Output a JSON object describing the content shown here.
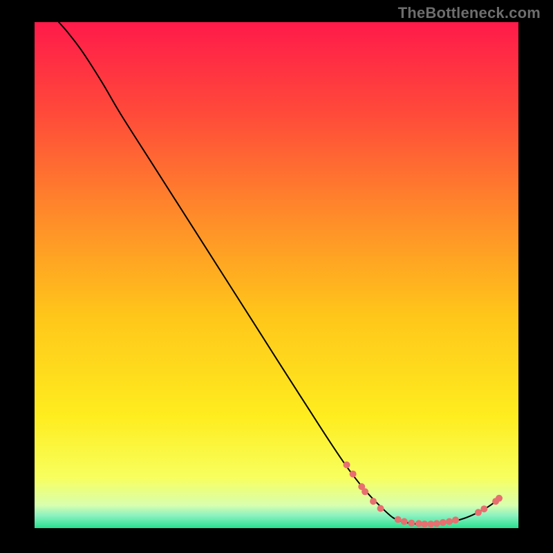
{
  "watermark": "TheBottleneck.com",
  "chart_data": {
    "type": "line",
    "title": "",
    "xlabel": "",
    "ylabel": "",
    "xlim": [
      0,
      100
    ],
    "ylim": [
      0,
      100
    ],
    "grid": false,
    "legend": false,
    "series": [
      {
        "name": "curve",
        "color": "#000000",
        "stroke_width": 2,
        "points": [
          {
            "x": 5.0,
            "y": 100.0
          },
          {
            "x": 7.0,
            "y": 97.8
          },
          {
            "x": 10.0,
            "y": 94.0
          },
          {
            "x": 14.0,
            "y": 88.0
          },
          {
            "x": 18.0,
            "y": 81.5
          },
          {
            "x": 25.0,
            "y": 71.0
          },
          {
            "x": 35.0,
            "y": 56.0
          },
          {
            "x": 45.0,
            "y": 41.0
          },
          {
            "x": 55.0,
            "y": 26.0
          },
          {
            "x": 65.0,
            "y": 11.5
          },
          {
            "x": 72.0,
            "y": 3.8
          },
          {
            "x": 76.0,
            "y": 1.3
          },
          {
            "x": 82.0,
            "y": 0.8
          },
          {
            "x": 88.0,
            "y": 1.7
          },
          {
            "x": 93.0,
            "y": 3.8
          },
          {
            "x": 96.0,
            "y": 5.8
          }
        ]
      },
      {
        "name": "dots",
        "type": "scatter",
        "color": "#e76f6f",
        "radius": 5,
        "points": [
          {
            "x": 64.5,
            "y": 12.5
          },
          {
            "x": 65.8,
            "y": 10.7
          },
          {
            "x": 67.6,
            "y": 8.2
          },
          {
            "x": 68.3,
            "y": 7.2
          },
          {
            "x": 70.0,
            "y": 5.3
          },
          {
            "x": 71.5,
            "y": 3.9
          },
          {
            "x": 75.1,
            "y": 1.7
          },
          {
            "x": 76.4,
            "y": 1.3
          },
          {
            "x": 77.9,
            "y": 1.0
          },
          {
            "x": 79.4,
            "y": 0.9
          },
          {
            "x": 80.6,
            "y": 0.8
          },
          {
            "x": 81.9,
            "y": 0.8
          },
          {
            "x": 83.1,
            "y": 0.9
          },
          {
            "x": 84.4,
            "y": 1.1
          },
          {
            "x": 85.7,
            "y": 1.3
          },
          {
            "x": 87.0,
            "y": 1.6
          },
          {
            "x": 91.7,
            "y": 3.1
          },
          {
            "x": 92.9,
            "y": 3.8
          },
          {
            "x": 95.3,
            "y": 5.3
          },
          {
            "x": 96.0,
            "y": 5.9
          }
        ]
      }
    ],
    "background": {
      "type": "linear-gradient",
      "direction": "vertical",
      "stops": [
        {
          "offset": 0.0,
          "color": "#ff1a4a"
        },
        {
          "offset": 0.18,
          "color": "#ff4a3a"
        },
        {
          "offset": 0.38,
          "color": "#ff8a2a"
        },
        {
          "offset": 0.58,
          "color": "#ffc61a"
        },
        {
          "offset": 0.78,
          "color": "#feed1f"
        },
        {
          "offset": 0.9,
          "color": "#f8ff5e"
        },
        {
          "offset": 0.955,
          "color": "#d8ffb0"
        },
        {
          "offset": 0.975,
          "color": "#8cf2c0"
        },
        {
          "offset": 1.0,
          "color": "#27e28f"
        }
      ]
    }
  }
}
